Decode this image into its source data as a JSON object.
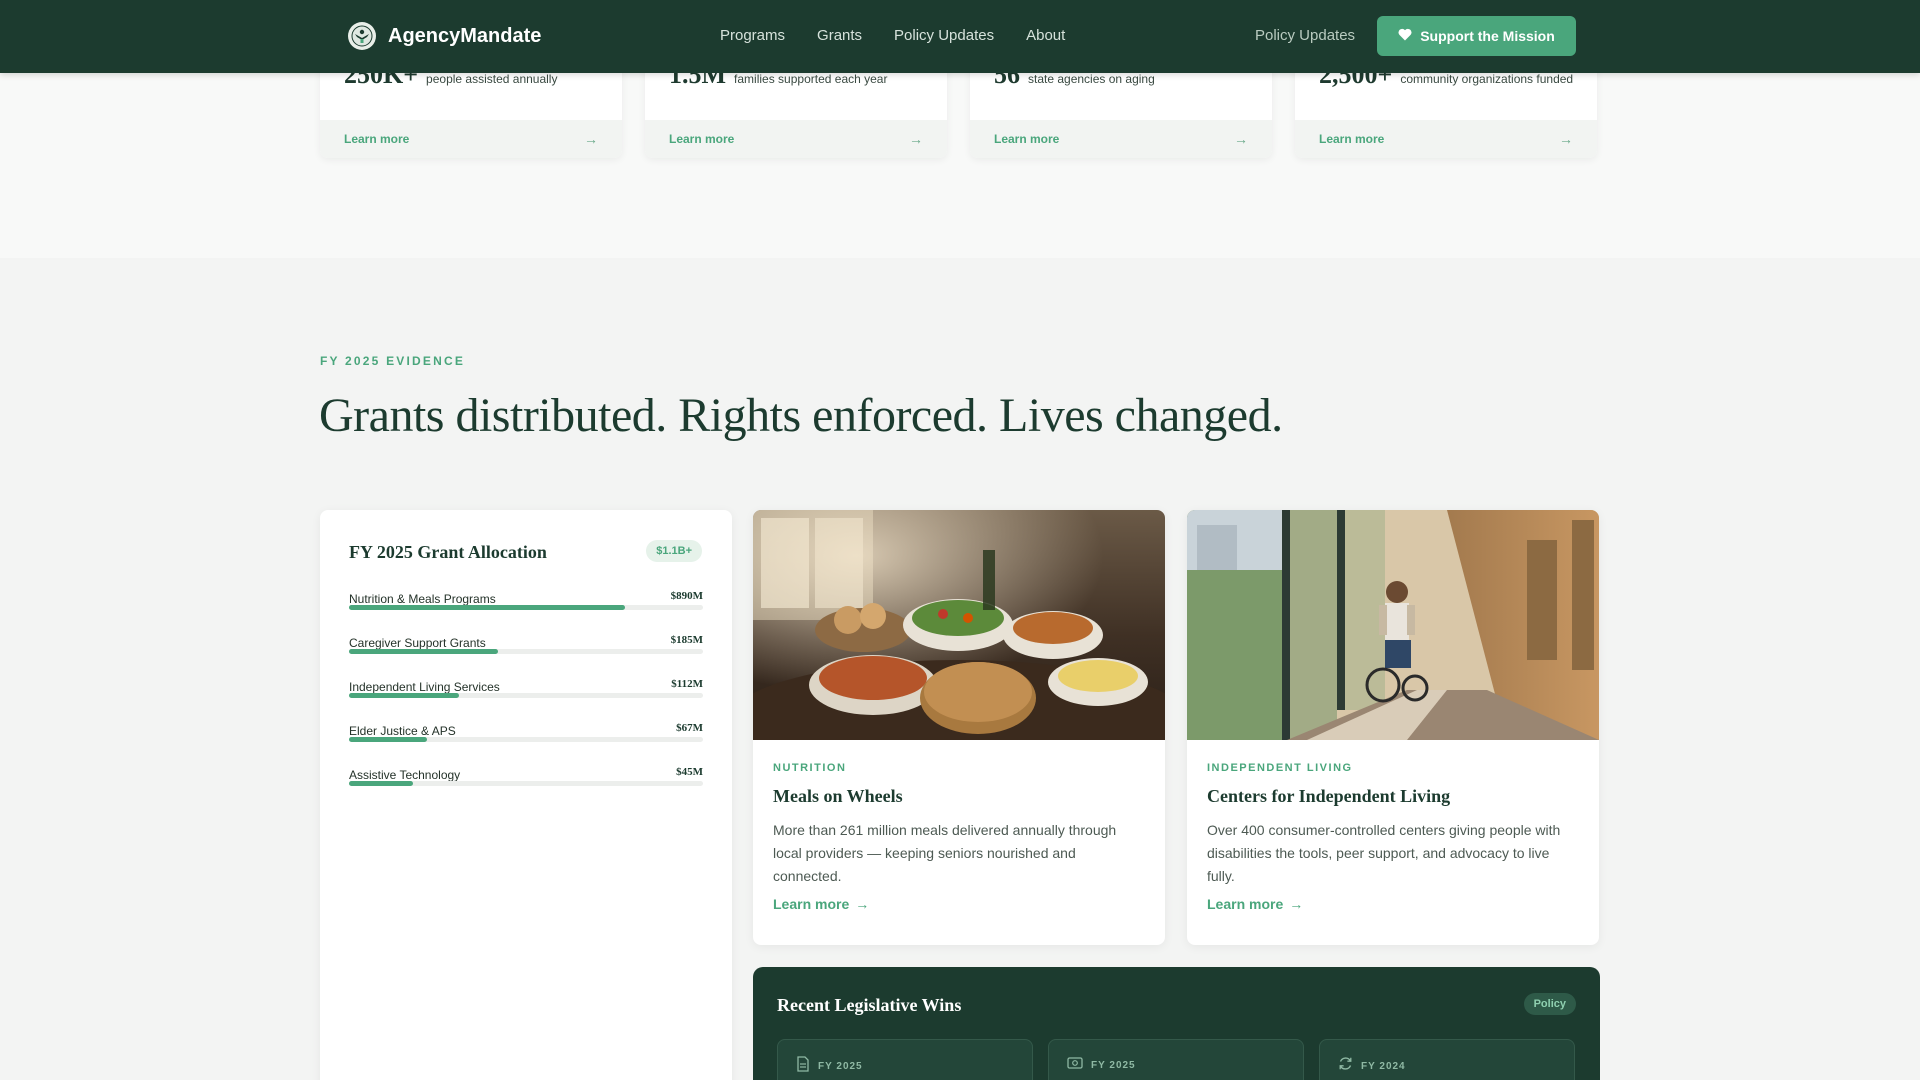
{
  "nav": {
    "brand": "AgencyMandate",
    "links": [
      "Programs",
      "Grants",
      "Policy Updates",
      "About"
    ],
    "right_link": "Policy Updates",
    "cta": "Support the Mission"
  },
  "stats": [
    {
      "value": "250K+",
      "desc": "people assisted annually",
      "link": "Learn more"
    },
    {
      "value": "1.5M",
      "desc": "families supported each year",
      "link": "Learn more"
    },
    {
      "value": "56",
      "desc": "state agencies on aging",
      "link": "Learn more"
    },
    {
      "value": "2,500+",
      "desc": "community organizations funded",
      "link": "Learn more"
    }
  ],
  "section": {
    "eyebrow": "FY 2025 EVIDENCE",
    "headline": "Grants distributed. Rights enforced. Lives changed."
  },
  "allocation": {
    "title": "FY 2025 Grant Allocation",
    "badge": "$1.1B+",
    "items": [
      {
        "label": "Nutrition & Meals Programs",
        "value": "$890M",
        "fraction": 0.78
      },
      {
        "label": "Caregiver Support Grants",
        "value": "$185M",
        "fraction": 0.42
      },
      {
        "label": "Independent Living Services",
        "value": "$112M",
        "fraction": 0.31
      },
      {
        "label": "Elder Justice & APS",
        "value": "$67M",
        "fraction": 0.22
      },
      {
        "label": "Assistive Technology",
        "value": "$45M",
        "fraction": 0.18
      }
    ]
  },
  "programs": [
    {
      "tag": "NUTRITION",
      "title": "Meals on Wheels",
      "desc": "More than 261 million meals delivered annually through local providers — keeping seniors nourished and connected.",
      "link": "Learn more"
    },
    {
      "tag": "INDEPENDENT LIVING",
      "title": "Centers for Independent Living",
      "desc": "Over 400 consumer-controlled centers giving people with disabilities the tools, peer support, and advocacy to live fully.",
      "link": "Learn more"
    }
  ],
  "legislative": {
    "title": "Recent Legislative Wins",
    "badge": "Policy",
    "items": [
      {
        "year": "FY 2025"
      },
      {
        "year": "FY 2025"
      },
      {
        "year": "FY 2024"
      }
    ]
  },
  "colors": {
    "brand_dark": "#1c3b2f",
    "accent": "#4aa67c"
  }
}
